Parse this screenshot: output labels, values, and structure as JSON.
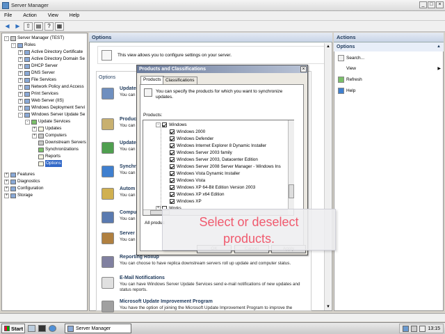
{
  "window": {
    "title": "Server Manager",
    "controls": [
      "_",
      "□",
      "×"
    ]
  },
  "menu": [
    "File",
    "Action",
    "View",
    "Help"
  ],
  "toolbar": {
    "buttons": [
      "back-arrow",
      "forward-arrow",
      "up-folder",
      "show-hide-tree",
      "help",
      "properties"
    ]
  },
  "tree": {
    "items": [
      {
        "label": "Server Manager (TEST)",
        "level": 0,
        "expander": "-",
        "icon": "srv"
      },
      {
        "label": "Roles",
        "level": 1,
        "expander": "-",
        "icon": "role"
      },
      {
        "label": "Active Directory Certificate",
        "level": 2,
        "expander": "+",
        "icon": "role"
      },
      {
        "label": "Active Directory Domain Se",
        "level": 2,
        "expander": "+",
        "icon": "role"
      },
      {
        "label": "DHCP Server",
        "level": 2,
        "expander": "+",
        "icon": "role"
      },
      {
        "label": "DNS Server",
        "level": 2,
        "expander": "+",
        "icon": "role"
      },
      {
        "label": "File Services",
        "level": 2,
        "expander": "+",
        "icon": "role"
      },
      {
        "label": "Network Policy and Access",
        "level": 2,
        "expander": "+",
        "icon": "role"
      },
      {
        "label": "Print Services",
        "level": 2,
        "expander": "+",
        "icon": "role"
      },
      {
        "label": "Web Server (IIS)",
        "level": 2,
        "expander": "+",
        "icon": "role"
      },
      {
        "label": "Windows Deployment Servi",
        "level": 2,
        "expander": "+",
        "icon": "role"
      },
      {
        "label": "Windows Server Update Se",
        "level": 2,
        "expander": "-",
        "icon": "role"
      },
      {
        "label": "Update Services",
        "level": 3,
        "expander": "-",
        "icon": "green"
      },
      {
        "label": "Updates",
        "level": 4,
        "expander": "+",
        "icon": "doc"
      },
      {
        "label": "Computers",
        "level": 4,
        "expander": "+",
        "icon": "srv"
      },
      {
        "label": "Downstream Servers",
        "level": 4,
        "expander": "",
        "icon": "srv"
      },
      {
        "label": "Synchronizations",
        "level": 4,
        "expander": "",
        "icon": "green"
      },
      {
        "label": "Reports",
        "level": 4,
        "expander": "",
        "icon": "doc"
      },
      {
        "label": "Options",
        "level": 4,
        "expander": "",
        "icon": "doc",
        "selected": true
      },
      {
        "label": "Features",
        "level": 0,
        "expander": "+",
        "icon": "role",
        "gap": true
      },
      {
        "label": "Diagnostics",
        "level": 0,
        "expander": "+",
        "icon": "role"
      },
      {
        "label": "Configuration",
        "level": 0,
        "expander": "+",
        "icon": "role"
      },
      {
        "label": "Storage",
        "level": 0,
        "expander": "+",
        "icon": "role"
      }
    ]
  },
  "center": {
    "header": "Options",
    "description": "This view allows you to configure settings on your server.",
    "panel_label": "Options",
    "items": [
      {
        "title": "Update",
        "desc": "You can | Minimal | e-lected",
        "color": "#6f8fbf"
      },
      {
        "title": "Produc",
        "desc": "You can | synchron",
        "color": "#c8b070"
      },
      {
        "title": "Update",
        "desc": "You can | which up",
        "color": "#4f9f4f"
      },
      {
        "title": "Synchr",
        "desc": "You can",
        "color": "#3f7fcf"
      },
      {
        "title": "Autom",
        "desc": "You can | how to s",
        "color": "#d0b050"
      },
      {
        "title": "Comput",
        "desc": "You can",
        "color": "#5a7ab0"
      },
      {
        "title": "Server",
        "desc": "You can | server.",
        "color": "#b08040"
      },
      {
        "title": "Reporting Rollup",
        "desc": "You can choose to have replica downstream servers roll up update and computer status.",
        "color": "#8080a0"
      },
      {
        "title": "E-Mail Notifications",
        "desc": "You can have Windows Server Update Services send e-mail notifications of new updates and status reports.",
        "color": "#e0e0e0"
      },
      {
        "title": "Microsoft Update Improvement Program",
        "desc": "You have the option of joining the Microsoft Update Improvement Program to improve the",
        "color": "#a0a0a0"
      }
    ]
  },
  "actions": {
    "header": "Actions",
    "section": "Options",
    "items": [
      {
        "label": "Search...",
        "icon": "search-icon",
        "submenu": false
      },
      {
        "label": "View",
        "icon": "",
        "submenu": true
      },
      {
        "label": "Refresh",
        "icon": "refresh-icon",
        "submenu": false
      },
      {
        "label": "Help",
        "icon": "help-icon",
        "submenu": false
      }
    ]
  },
  "dialog": {
    "title": "Products and Classifications",
    "tabs": [
      "Products",
      "Classifications"
    ],
    "info": "You can specify the products for which you want to synchronize updates.",
    "products_label": "Products:",
    "products": [
      {
        "label": "Windows",
        "level": 0,
        "checked": true,
        "expander": "-"
      },
      {
        "label": "Windows 2000",
        "level": 1,
        "checked": true
      },
      {
        "label": "Windows Defender",
        "level": 1,
        "checked": true
      },
      {
        "label": "Windows Internet Explorer 8 Dynamic Installer",
        "level": 1,
        "checked": true
      },
      {
        "label": "Windows Server 2003 family",
        "level": 1,
        "checked": true
      },
      {
        "label": "Windows Server 2003, Datacenter Edition",
        "level": 1,
        "checked": true
      },
      {
        "label": "Windows Server 2008 Server Manager - Windows Ins",
        "level": 1,
        "checked": true
      },
      {
        "label": "Windows Vista Dynamic Installer",
        "level": 1,
        "checked": true
      },
      {
        "label": "Windows Vista",
        "level": 1,
        "checked": true
      },
      {
        "label": "Windows XP 64-Bit Edition Version 2003",
        "level": 1,
        "checked": true
      },
      {
        "label": "Windows XP x64 Edition",
        "level": 1,
        "checked": true
      },
      {
        "label": "Windows XP",
        "level": 1,
        "checked": true
      },
      {
        "label": "Works",
        "level": 0,
        "checked": false,
        "expander": "+"
      }
    ],
    "all_products_prefix": "All produc",
    "buttons": [
      "OK",
      "Cancel",
      "Apply"
    ]
  },
  "callout": {
    "line1": "Select or deselect",
    "line2": "products."
  },
  "taskbar": {
    "start": "Start",
    "task": "Server Manager",
    "clock": "13:15"
  }
}
